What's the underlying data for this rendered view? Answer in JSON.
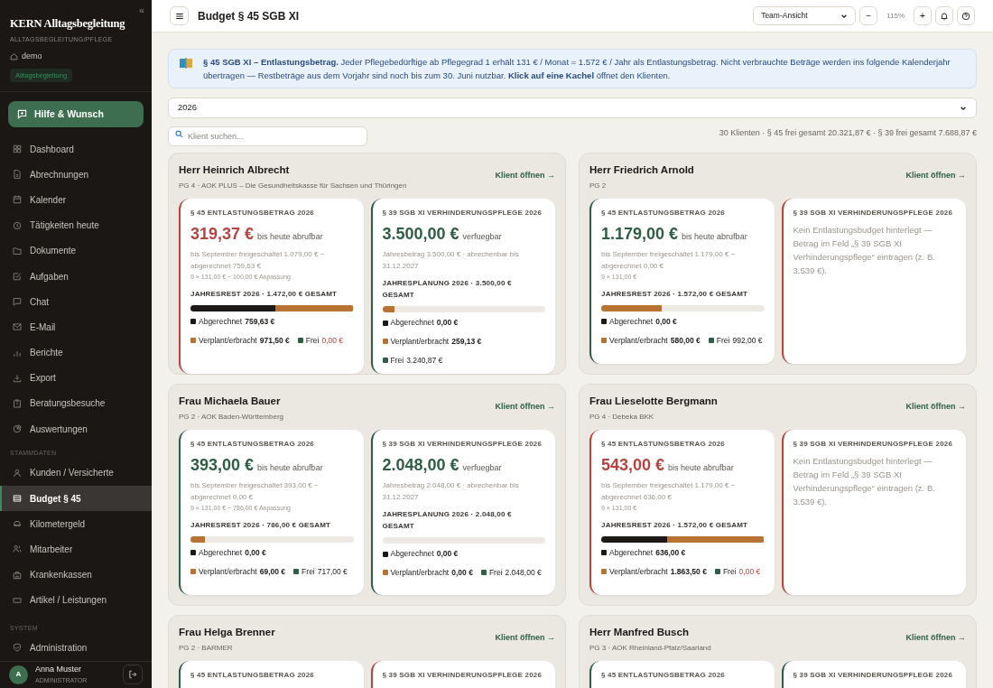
{
  "sidebar": {
    "brand": "KERN Alltagsbegleitung",
    "subtitle": "ALLTAGSBEGLEITUNG/PFLEGE",
    "tenant": "demo",
    "badge": "Alltagsbegleitung",
    "collapse": "«",
    "help_button": "Hilfe & Wunsch",
    "sections": [
      {
        "items": [
          {
            "label": "Dashboard",
            "selected": false
          },
          {
            "label": "Abrechnungen",
            "selected": false
          },
          {
            "label": "Kalender",
            "selected": false
          },
          {
            "label": "Tätigkeiten heute",
            "selected": false
          },
          {
            "label": "Dokumente",
            "selected": false
          },
          {
            "label": "Aufgaben",
            "selected": false
          },
          {
            "label": "Chat",
            "selected": false
          },
          {
            "label": "E-Mail",
            "selected": false
          },
          {
            "label": "Berichte",
            "selected": false
          },
          {
            "label": "Export",
            "selected": false
          },
          {
            "label": "Beratungsbesuche",
            "selected": false
          },
          {
            "label": "Auswertungen",
            "selected": false
          }
        ]
      },
      {
        "label": "STAMMDATEN",
        "items": [
          {
            "label": "Kunden / Versicherte",
            "selected": false
          },
          {
            "label": "Budget § 45",
            "selected": true
          },
          {
            "label": "Kilometergeld",
            "selected": false
          },
          {
            "label": "Mitarbeiter",
            "selected": false
          },
          {
            "label": "Krankenkassen",
            "selected": false
          },
          {
            "label": "Artikel / Leistungen",
            "selected": false
          }
        ]
      },
      {
        "label": "SYSTEM",
        "items": [
          {
            "label": "Administration",
            "selected": false
          }
        ]
      }
    ],
    "user": {
      "initial": "A",
      "name": "Anna Muster",
      "role": "ADMINISTRATOR"
    }
  },
  "header": {
    "title": "Budget § 45 SGB XI",
    "view": "Team-Ansicht",
    "zoom_out": "−",
    "zoom": "115%",
    "zoom_in": "+"
  },
  "banner": "**§ 45 SGB XI – Entlastungsbetrag.** Jeder Pflegebedürftige ab Pflegegrad 1 erhält 131 € / Monat = 1.572 € / Jahr als Entlastungsbetrag. Nicht verbrauchte Beträge werden ins folgende Kalenderjahr übertragen — Restbeträge aus dem Vorjahr sind noch bis zum 30. Juni nutzbar. **Klick auf eine Kachel** öffnet den Klienten.",
  "year": "2026",
  "search": {
    "placeholder": "Klient suchen..."
  },
  "summary": "30 Klienten · § 45 frei gesamt 20.321,87 € · § 39 frei gesamt 7.688,87 €",
  "clients": [
    {
      "name": "Herr Heinrich Albrecht",
      "meta": "PG 4 · AOK PLUS – Die Gesundheitskasse für Sachsen und Thüringen",
      "open": "Klient öffnen →",
      "budgets": [
        {
          "kind": "amount",
          "color": "#b5443f",
          "title": "§ 45 ENTLASTUNGSBETRAG 2026",
          "amount": "319,37 €",
          "note": "bis heute abrufbar",
          "details": "bis September freigeschaltet 1.079,00 € − abgerechnet 759,63 €",
          "formula": "9 × 131,00 € − 100,00 € Anpassung",
          "total": "JAHRESREST 2026 · 1.472,00 € GESAMT",
          "bar": [
            {
              "color": "#1c1917",
              "level": 0.52
            },
            {
              "color": "#b87333",
              "level": 0.48
            }
          ],
          "legend": [
            {
              "label": "Abgerechnet",
              "value": "759,63 €",
              "color": "#1c1917",
              "warning": false
            },
            {
              "label": "Verplant/erbracht",
              "value": "971,50 €",
              "color": "#b87333",
              "warning": false
            },
            {
              "label": "Frei",
              "value": "0,00 €",
              "color": "#2f5d45",
              "warning": true
            }
          ]
        },
        {
          "kind": "amount",
          "color": "#2f5d45",
          "title": "§ 39 SGB XI VERHINDERUNGSPFLEGE 2026",
          "amount": "3.500,00 €",
          "note": "verfuegbar",
          "details": "Jahresbetrag 3.500,00 € · abrechenbar bis 31.12.2027",
          "total": "JAHRESPLANUNG 2026 · 3.500,00 € GESAMT",
          "bar": [
            {
              "color": "#b87333",
              "level": 0.074
            }
          ],
          "legend": [
            {
              "label": "Abgerechnet",
              "value": "0,00 €",
              "color": "#1c1917",
              "warning": false
            },
            {
              "label": "Verplant/erbracht",
              "value": "259,13 €",
              "color": "#b87333",
              "warning": false
            },
            {
              "label": "Frei",
              "value": "3.240,87 €",
              "color": "#2f5d45",
              "warning": false
            }
          ]
        }
      ]
    },
    {
      "name": "Herr Friedrich Arnold",
      "meta": "PG 2",
      "open": "Klient öffnen →",
      "budgets": [
        {
          "kind": "amount",
          "color": "#2f5d45",
          "title": "§ 45 ENTLASTUNGSBETRAG 2026",
          "amount": "1.179,00 €",
          "note": "bis heute abrufbar",
          "details": "bis September freigeschaltet 1.179,00 € − abgerechnet 0,00 €",
          "formula": "9 × 131,00 €",
          "total": "JAHRESREST 2026 · 1.572,00 € GESAMT",
          "bar": [
            {
              "color": "#b87333",
              "level": 0.37
            }
          ],
          "legend": [
            {
              "label": "Abgerechnet",
              "value": "0,00 €",
              "color": "#1c1917",
              "warning": false
            },
            {
              "label": "Verplant/erbracht",
              "value": "580,00 €",
              "color": "#b87333",
              "warning": false
            },
            {
              "label": "Frei",
              "value": "992,00 €",
              "color": "#2f5d45",
              "warning": false
            }
          ]
        },
        {
          "kind": "empty",
          "color": "#b5443f",
          "title": "§ 39 SGB XI VERHINDERUNGSPFLEGE 2026",
          "message": "Kein Entlastungsbudget hinterlegt — Betrag im Feld „§ 39 SGB XI Verhinderungspflege“ eintragen (z. B. 3.539 €)."
        }
      ]
    },
    {
      "name": "Frau Michaela Bauer",
      "meta": "PG 2 · AOK Baden-Württemberg",
      "open": "Klient öffnen →",
      "budgets": [
        {
          "kind": "amount",
          "color": "#2f5d45",
          "title": "§ 45 ENTLASTUNGSBETRAG 2026",
          "amount": "393,00 €",
          "note": "bis heute abrufbar",
          "details": "bis September freigeschaltet 393,00 € − abgerechnet 0,00 €",
          "formula": "9 × 131,00 € − 786,00 € Anpassung",
          "total": "JAHRESREST 2026 · 786,00 € GESAMT",
          "bar": [
            {
              "color": "#b87333",
              "level": 0.088
            }
          ],
          "legend": [
            {
              "label": "Abgerechnet",
              "value": "0,00 €",
              "color": "#1c1917",
              "warning": false
            },
            {
              "label": "Verplant/erbracht",
              "value": "69,00 €",
              "color": "#b87333",
              "warning": false
            },
            {
              "label": "Frei",
              "value": "717,00 €",
              "color": "#2f5d45",
              "warning": false
            }
          ]
        },
        {
          "kind": "amount",
          "color": "#2f5d45",
          "title": "§ 39 SGB XI VERHINDERUNGSPFLEGE 2026",
          "amount": "2.048,00 €",
          "note": "verfuegbar",
          "details": "Jahresbetrag 2.048,00 € · abrechenbar bis 31.12.2027",
          "total": "JAHRESPLANUNG 2026 · 2.048,00 € GESAMT",
          "legend": [
            {
              "label": "Abgerechnet",
              "value": "0,00 €",
              "color": "#1c1917",
              "warning": false
            },
            {
              "label": "Verplant/erbracht",
              "value": "0,00 €",
              "color": "#b87333",
              "warning": false
            },
            {
              "label": "Frei",
              "value": "2.048,00 €",
              "color": "#2f5d45",
              "warning": false
            }
          ]
        }
      ]
    },
    {
      "name": "Frau Lieselotte Bergmann",
      "meta": "PG 4 · Debeka BKK",
      "open": "Klient öffnen →",
      "budgets": [
        {
          "kind": "amount",
          "color": "#b5443f",
          "title": "§ 45 ENTLASTUNGSBETRAG 2026",
          "amount": "543,00 €",
          "note": "bis heute abrufbar",
          "details": "bis September freigeschaltet 1.179,00 € − abgerechnet 636,00 €",
          "formula": "9 × 131,00 €",
          "total": "JAHRESREST 2026 · 1.572,00 € GESAMT",
          "bar": [
            {
              "color": "#1c1917",
              "level": 0.405
            },
            {
              "color": "#b87333",
              "level": 0.595
            }
          ],
          "legend": [
            {
              "label": "Abgerechnet",
              "value": "636,00 €",
              "color": "#1c1917",
              "warning": false
            },
            {
              "label": "Verplant/erbracht",
              "value": "1.863,50 €",
              "color": "#b87333",
              "warning": false
            },
            {
              "label": "Frei",
              "value": "0,00 €",
              "color": "#2f5d45",
              "warning": true
            }
          ]
        },
        {
          "kind": "empty",
          "color": "#b5443f",
          "title": "§ 39 SGB XI VERHINDERUNGSPFLEGE 2026",
          "message": "Kein Entlastungsbudget hinterlegt — Betrag im Feld „§ 39 SGB XI Verhinderungspflege“ eintragen (z. B. 3.539 €)."
        }
      ]
    },
    {
      "name": "Frau Helga Brenner",
      "meta": "PG 2 · BARMER",
      "open": "Klient öffnen →",
      "budgets": [
        {
          "kind": "amount",
          "color": "#2f5d45",
          "title": "§ 45 ENTLASTUNGSBETRAG 2026"
        },
        {
          "kind": "empty",
          "color": "#b5443f",
          "title": "§ 39 SGB XI VERHINDERUNGSPFLEGE 2026"
        }
      ]
    },
    {
      "name": "Herr Manfred Busch",
      "meta": "PG 3 · AOK Rheinland-Pfalz/Saarland",
      "open": "Klient öffnen →",
      "budgets": [
        {
          "kind": "amount",
          "color": "#2f5d45",
          "title": "§ 45 ENTLASTUNGSBETRAG 2026"
        },
        {
          "kind": "amount",
          "color": "#2f5d45",
          "title": "§ 39 SGB XI VERHINDERUNGSPFLEGE 2026"
        }
      ]
    }
  ]
}
